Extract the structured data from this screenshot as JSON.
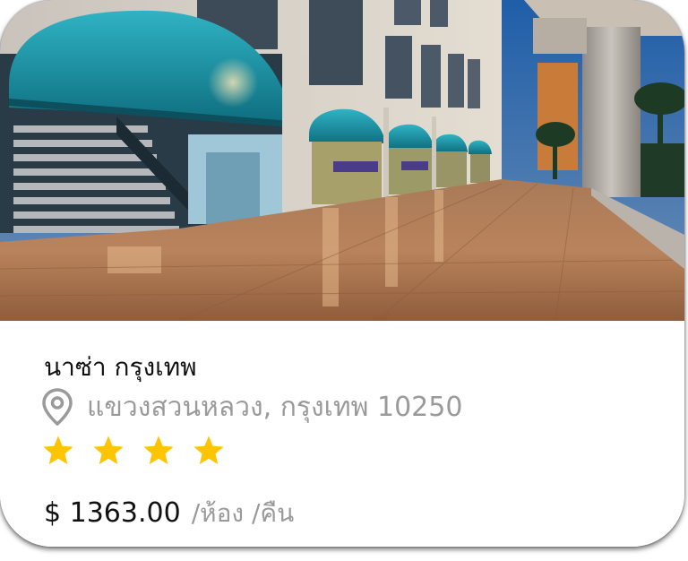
{
  "hotel": {
    "name": "นาซ่า กรุงเทพ",
    "address": "แขวงสวนหลวง, กรุงเทพ 10250",
    "rating": 4,
    "price": "$ 1363.00",
    "price_unit": "/ห้อง /คืน"
  },
  "icons": {
    "location": "location-pin-icon",
    "star": "star-icon"
  },
  "colors": {
    "star": "#ffc400",
    "pin": "#9a9a9a",
    "title": "#111111",
    "secondary_text": "#9a9a9a"
  }
}
